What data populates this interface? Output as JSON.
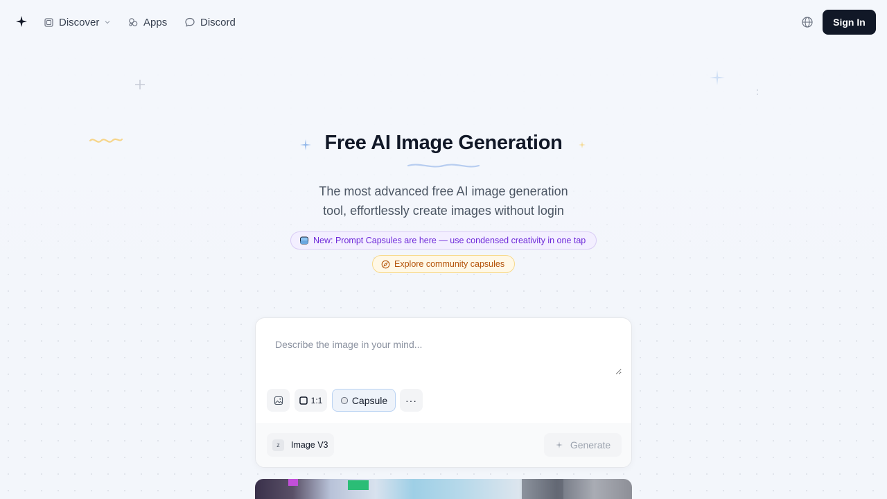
{
  "nav": {
    "logo_icon": "sparkle-logo-icon",
    "items": [
      {
        "label": "Discover",
        "icon": "discover-icon",
        "has_dropdown": true
      },
      {
        "label": "Apps",
        "icon": "apps-icon"
      },
      {
        "label": "Discord",
        "icon": "discord-chat-icon"
      }
    ],
    "language_icon": "globe-icon",
    "signin_label": "Sign In"
  },
  "hero": {
    "title": "Free AI Image Generation",
    "subtitle_line1": "The most advanced free AI image generation",
    "subtitle_line2": "tool, effortlessly create images without login"
  },
  "announcements": {
    "new_label": "New: Prompt Capsules are here — use condensed creativity in one tap",
    "explore_label": "Explore community capsules"
  },
  "prompt": {
    "placeholder": "Describe the image in your mind...",
    "value": "",
    "tools": {
      "image_icon": "image-upload-icon",
      "ratio_label": "1:1",
      "capsule_label": "Capsule",
      "more_label": "···"
    },
    "model": {
      "badge": "z",
      "label": "Image V3"
    },
    "generate_label": "Generate"
  },
  "colors": {
    "accent_dark": "#111827",
    "capsule_purple": "#6d28d9",
    "explore_amber": "#b45309",
    "background": "#f3f6fb"
  }
}
